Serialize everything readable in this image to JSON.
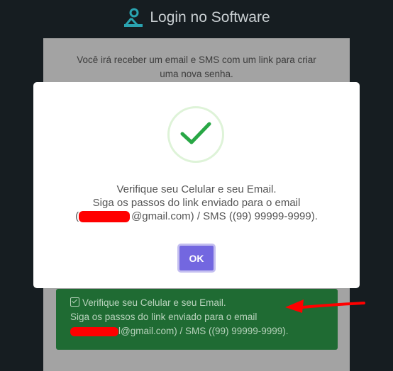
{
  "header": {
    "title": "Login no Software",
    "logo_icon": "user-settings-icon"
  },
  "card": {
    "info_line1": "Você irá receber um email e SMS com um link para criar",
    "info_line2": "uma nova senha."
  },
  "alert": {
    "line1": "Verifique seu Celular e seu Email.",
    "line2": "Siga os passos do link enviado para o email",
    "line3_suffix": "l@gmail.com) / SMS ((99) 99999-9999).",
    "icon": "checkbox-icon",
    "background": "#1f6b33"
  },
  "modal": {
    "line1": "Verifique seu Celular e seu Email.",
    "line2": "Siga os passos do link enviado para o email",
    "line3_suffix": "@gmail.com) / SMS ((99) 99999-9999).",
    "line3_prefix": "(",
    "ok_label": "OK",
    "icon": "success-check-icon",
    "accent": "#7367e0",
    "success_color": "#28a745"
  },
  "annotation": {
    "icon": "red-arrow-icon",
    "color": "#ff0000"
  }
}
